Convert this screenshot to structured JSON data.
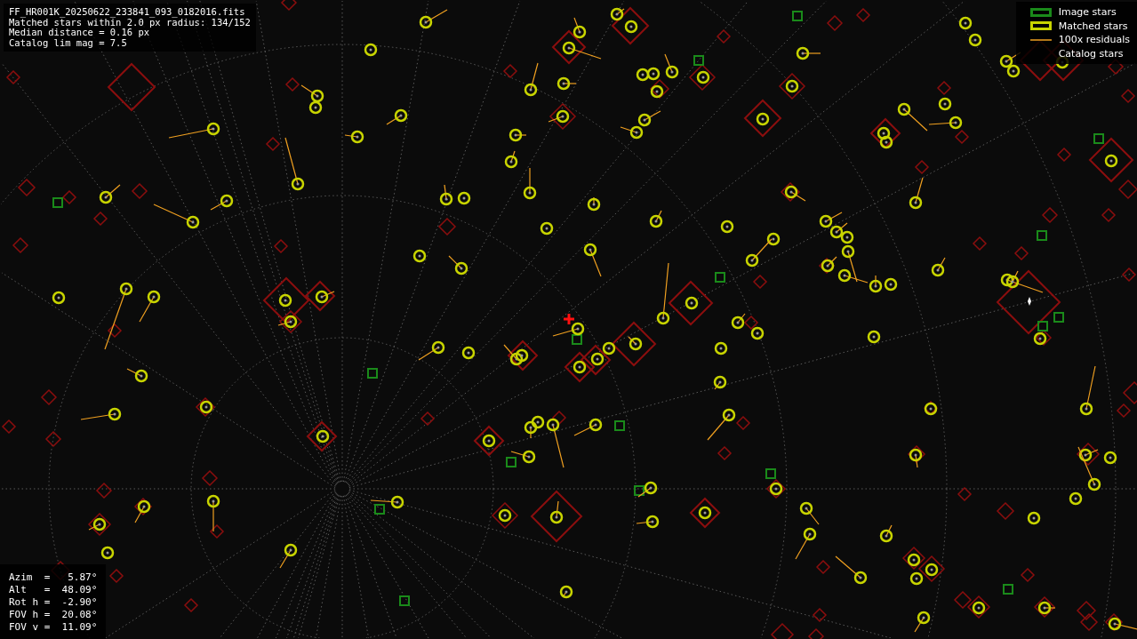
{
  "header": {
    "lines": [
      "FF_HR001K_20250622_233841_093_0182016.fits",
      "Matched stars within 2.0 px radius: 134/152",
      "Median distance = 0.16 px",
      "Catalog lim mag = 7.5"
    ]
  },
  "legend": {
    "items": [
      {
        "label": "Image stars",
        "kind": "image"
      },
      {
        "label": "Matched stars",
        "kind": "matched"
      },
      {
        "label": "100x residuals",
        "kind": "residual"
      },
      {
        "label": "Catalog stars",
        "kind": "catalog"
      }
    ]
  },
  "pointing": {
    "lines": [
      "Azim  =   5.87°",
      "Alt   =  48.09°",
      "Rot h =  -2.90°",
      "FOV h =  20.08°",
      "FOV v =  11.09°"
    ]
  }
}
